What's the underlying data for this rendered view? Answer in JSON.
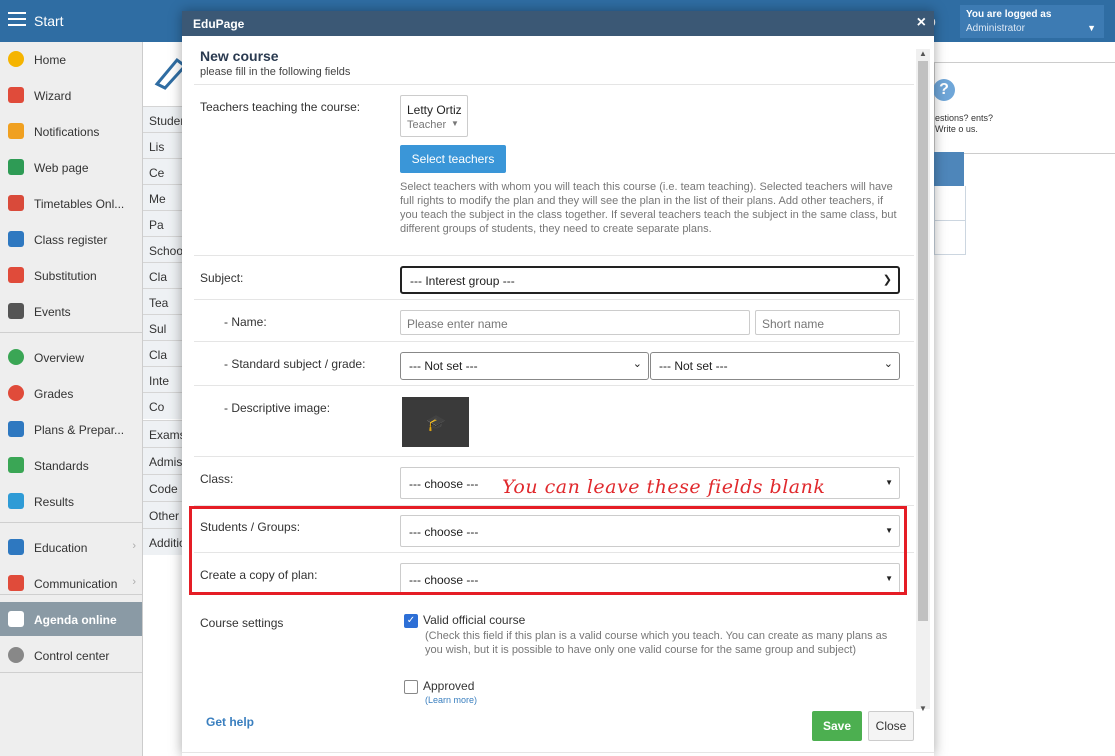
{
  "app": {
    "start_label": "Start",
    "p_letter": "p"
  },
  "account": {
    "logged_label": "You are logged as",
    "role": "Administrator"
  },
  "sidebar": {
    "items": [
      {
        "label": "Home",
        "icon": "star-icon",
        "color": "#f5b400"
      },
      {
        "label": "Wizard",
        "icon": "wand-icon",
        "color": "#e04b3a"
      },
      {
        "label": "Notifications",
        "icon": "envelope-icon",
        "color": "#f0a020"
      },
      {
        "label": "Web page",
        "icon": "house-icon",
        "color": "#2e9b55"
      },
      {
        "label": "Timetables Onl...",
        "icon": "grid-icon",
        "color": "#d94a3a"
      },
      {
        "label": "Class register",
        "icon": "book-icon",
        "color": "#2e78c0"
      },
      {
        "label": "Substitution",
        "icon": "person-icon",
        "color": "#e04b3a"
      },
      {
        "label": "Events",
        "icon": "calendar-icon",
        "color": "#555555"
      },
      {
        "label": "Overview",
        "icon": "check-circle-icon",
        "color": "#3aa655"
      },
      {
        "label": "Grades",
        "icon": "chart-circle-icon",
        "color": "#e04b3a"
      },
      {
        "label": "Plans & Prepar...",
        "icon": "briefcase-icon",
        "color": "#2e78c0"
      },
      {
        "label": "Standards",
        "icon": "shield-icon",
        "color": "#3aa655"
      },
      {
        "label": "Results",
        "icon": "bar-chart-icon",
        "color": "#2e9bd6"
      },
      {
        "label": "Education",
        "icon": "open-book-icon",
        "color": "#2e78c0"
      },
      {
        "label": "Communication",
        "icon": "chat-icon",
        "color": "#e04b3a"
      },
      {
        "label": "Agenda online",
        "icon": "pen-icon",
        "color": "#ffffff"
      },
      {
        "label": "Control center",
        "icon": "gear-icon",
        "color": "#888888"
      }
    ]
  },
  "bg_tabs": [
    "Studen",
    "Lis",
    "Ce",
    "Me",
    "Pa",
    "Schoo",
    "Cla",
    "Tea",
    "Sul",
    "Cla",
    "Inte",
    "Co",
    "Exams",
    "Admis",
    "Code",
    "Other",
    "Additio"
  ],
  "bg_help": {
    "q": "?",
    "text": "estions? ents? Write o us."
  },
  "modal": {
    "title": "EduPage",
    "close_symbol": "×",
    "heading": "New course",
    "subheading": "please fill in the following fields",
    "teachers_label": "Teachers teaching the course:",
    "teacher": {
      "name": "Letty Ortiz",
      "role": "Teacher"
    },
    "select_teachers_button": "Select teachers",
    "teachers_help": "Select teachers with whom you will teach this course (i.e. team teaching). Selected teachers will have full rights to modify the plan and they will see the plan in the list of their plans. Add other teachers, if you teach the subject in the class together. If several teachers teach the subject in the same class, but different groups of students, they need to create separate plans.",
    "subject_label": "Subject:",
    "subject_value": "--- Interest group ---",
    "name_label": "- Name:",
    "name_placeholder": "Please enter name",
    "short_name_placeholder": "Short name",
    "standard_label": "- Standard subject / grade:",
    "standard_subject": "--- Not set ---",
    "standard_grade": "--- Not set ---",
    "image_label": "- Descriptive image:",
    "class_label": "Class:",
    "class_value": "--- choose ---",
    "students_label": "Students / Groups:",
    "students_value": "--- choose ---",
    "copy_label": "Create a copy of plan:",
    "copy_value": "--- choose ---",
    "annotation": "You can leave these fields blank",
    "course_settings_label": "Course settings",
    "valid_official_label": "Valid official course",
    "valid_official_checked": true,
    "valid_official_note": "(Check this field if this plan is a valid course which you teach. You can create as many plans as you wish, but it is possible to have only one valid course for the same group and subject)",
    "approved_label": "Approved",
    "approved_checked": false,
    "learn_more": "(Learn more)",
    "get_help": "Get help",
    "save_button": "Save",
    "close_button": "Close"
  }
}
